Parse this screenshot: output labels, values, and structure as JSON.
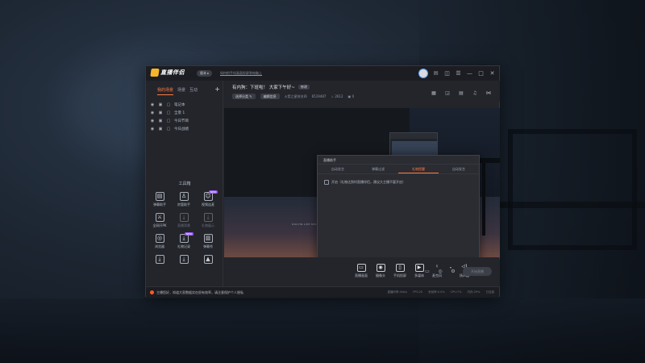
{
  "app": {
    "name": "直播伴侣",
    "version_label": "版本",
    "notice": "如何把手机画面投屏到电脑上"
  },
  "sidebar": {
    "tabs": [
      "我的场景",
      "场景",
      "互动"
    ],
    "active_tab": 0,
    "scenes": [
      {
        "name": "笔记本"
      },
      {
        "name": "全景 1"
      },
      {
        "name": "今日节目"
      },
      {
        "name": "今日战绩"
      }
    ],
    "toolbox_title": "工具箱",
    "tools": [
      {
        "label": "弹幕助手",
        "icon": "danmaku-icon"
      },
      {
        "label": "房管助手",
        "icon": "user-icon"
      },
      {
        "label": "视频连麦",
        "icon": "video-call-icon",
        "badge": "NEW"
      },
      {
        "label": "全网开PK",
        "icon": "pk-icon"
      },
      {
        "label": "直播背景",
        "icon": "download-icon",
        "dim": true
      },
      {
        "label": "礼物展示",
        "icon": "download-icon",
        "dim": true
      },
      {
        "label": "浏览器",
        "icon": "browser-icon"
      },
      {
        "label": "礼物记录",
        "icon": "download-icon",
        "badge": "NEW"
      },
      {
        "label": "弹幕秀",
        "icon": "chart-icon"
      },
      {
        "label": "",
        "icon": "download-icon"
      },
      {
        "label": "",
        "icon": "download-icon"
      },
      {
        "label": "",
        "icon": "mountain-icon"
      }
    ]
  },
  "header": {
    "room_title": "有内狗：下班啦！ 大家下午好~",
    "modify_label": "修改",
    "edit_info_label": "编辑信息",
    "category_label": "选择分类",
    "meta": [
      "火箭之星排名四",
      "6519487",
      "2612",
      "0"
    ]
  },
  "dialog": {
    "title": "直播助手",
    "tabs": [
      "自动发言",
      "弹幕过滤",
      "礼物提醒",
      "自动发言"
    ],
    "active_tab": 2,
    "checkbox_label": "开启（礼物达到时直播伴侣，建议大主播不要开启）"
  },
  "preview": {
    "caption": "DOUYIN LIVE STUDIO"
  },
  "controls": {
    "items": [
      {
        "label": "直播画面",
        "icon": "screen-icon"
      },
      {
        "label": "摄像头",
        "icon": "camera-icon"
      },
      {
        "label": "手机投屏",
        "icon": "phone-icon"
      },
      {
        "label": "多媒体",
        "icon": "media-icon"
      },
      {
        "label": "麦克风",
        "icon": "mic-icon"
      },
      {
        "label": "扬声器",
        "icon": "speaker-icon"
      }
    ],
    "go_live_label": "开始直播"
  },
  "status": {
    "message": "主播您好，知道大家数据实在很有效率，请注意保护个人隐私",
    "items": [
      "直播码率:0kb/s",
      "FPS:20",
      "丢帧率:0.0%",
      "CPU:7%",
      "内存:29%",
      "已连接"
    ]
  },
  "colors": {
    "accent": "#ff7a45",
    "bg": "#23252b",
    "titlebar": "#1b1d22"
  }
}
